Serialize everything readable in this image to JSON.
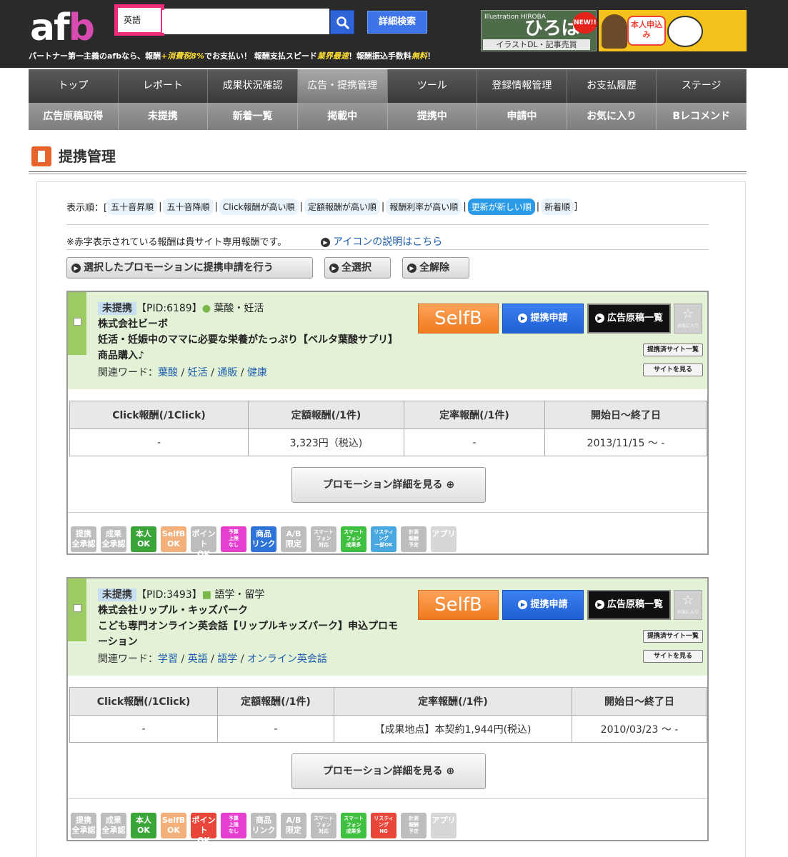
{
  "header": {
    "logo_a": "af",
    "logo_b": "b",
    "tagline_1": "パートナー第一主義のafbなら、報酬",
    "tagline_tax": "+消費税8%",
    "tagline_2": "でお支払い！ 報酬支払スピード",
    "tagline_fast": "業界最速",
    "tagline_3": "！報酬振込手数料",
    "tagline_free": "無料",
    "tagline_4": "！",
    "search_keyword": "英語",
    "search_placeholder": "",
    "advanced_search": "詳細検索",
    "banner1_small": "Illustration HIROBA",
    "banner1_title": "ひろば",
    "banner1_sub": "イラストDL・記事売買",
    "banner1_new": "NEW!!",
    "banner2_text": "本人申込み"
  },
  "nav1": [
    "トップ",
    "レポート",
    "成果状況確認",
    "広告・提携管理",
    "ツール",
    "登録情報管理",
    "お支払履歴",
    "ステージ"
  ],
  "nav1_active": 3,
  "nav2": [
    "広告原稿取得",
    "未提携",
    "新着一覧",
    "掲載中",
    "提携中",
    "申請中",
    "お気に入り",
    "Bレコメンド"
  ],
  "page_title": "提携管理",
  "sort": {
    "label": "表示順：[",
    "close": "]",
    "options": [
      "五十音昇順",
      "五十音降順",
      "Click報酬が高い順",
      "定額報酬が高い順",
      "報酬利率が高い順",
      "更新が新しい順",
      "新着順"
    ],
    "selected": 5
  },
  "note": "※赤字表示されている報酬は貴サイト専用報酬です。",
  "icon_help_link": "アイコンの説明はこちら",
  "actions": {
    "apply_selected": "選択したプロモーションに提携申請を行う",
    "select_all": "全選択",
    "clear_all": "全解除"
  },
  "promotions": [
    {
      "status": "未提携",
      "pid": "【PID:6189】",
      "category": "葉酸・妊活",
      "company": "株式会社ビーボ",
      "description": "妊活・妊娠中のママに必要な栄養がたっぷり【ベルタ葉酸サプリ】商品購入♪",
      "keywords_label": "関連ワード：",
      "keywords": [
        "葉酸",
        "妊活",
        "通販",
        "健康"
      ],
      "selfb": "SelfB",
      "apply": "提携申請",
      "ad_list": "広告原稿一覧",
      "fav": "☆",
      "fav_sub": "お気に入り",
      "affiliated_sites": "提携済サイト一覧",
      "view_site": "サイトを見る",
      "headers": [
        "Click報酬(/1Click)",
        "定額報酬(/1件)",
        "定率報酬(/1件)",
        "開始日〜終了日"
      ],
      "values": [
        "-",
        "3,323円（税込)",
        "-",
        "2013/11/15 〜 -"
      ],
      "detail": "プロモーション詳細を見る",
      "icons": [
        {
          "t": "提携\n全承認",
          "c": "#bdbdbd"
        },
        {
          "t": "成果\n全承認",
          "c": "#bdbdbd"
        },
        {
          "t": "本人\nOK",
          "c": "#3aa63a"
        },
        {
          "t": "SelfB\nOK",
          "c": "#f3b07a"
        },
        {
          "t": "ポイント\nOK",
          "c": "#bdbdbd"
        },
        {
          "t": "予算\n上限\nなし",
          "c": "#e63fd0"
        },
        {
          "t": "商品\nリンク",
          "c": "#2e74d8"
        },
        {
          "t": "A/B\n限定",
          "c": "#bdbdbd"
        },
        {
          "t": "スマート\nフォン\n対応",
          "c": "#bdbdbd"
        },
        {
          "t": "スマート\nフォン\n成果多",
          "c": "#40c040"
        },
        {
          "t": "リスティ\nング\n一部OK",
          "c": "#4aa8e0"
        },
        {
          "t": "計測\n報酬\n予定",
          "c": "#bdbdbd"
        },
        {
          "t": "アプリ",
          "c": "#d6d6d6"
        }
      ]
    },
    {
      "status": "未提携",
      "pid": "【PID:3493】",
      "category": "語学・留学",
      "company": "株式会社リップル・キッズパーク",
      "description": "こども専門オンライン英会話【リップルキッズパーク】申込プロモーション",
      "keywords_label": "関連ワード：",
      "keywords": [
        "学習",
        "英語",
        "語学",
        "オンライン英会話"
      ],
      "selfb": "SelfB",
      "apply": "提携申請",
      "ad_list": "広告原稿一覧",
      "fav": "☆",
      "fav_sub": "お気に入り",
      "affiliated_sites": "提携済サイト一覧",
      "view_site": "サイトを見る",
      "headers": [
        "Click報酬(/1Click)",
        "定額報酬(/1件)",
        "定率報酬(/1件)",
        "開始日〜終了日"
      ],
      "values": [
        "-",
        "-",
        "【成果地点】本契約1,944円(税込)",
        "2010/03/23 〜 -"
      ],
      "detail": "プロモーション詳細を見る",
      "icons": [
        {
          "t": "提携\n全承認",
          "c": "#bdbdbd"
        },
        {
          "t": "成果\n全承認",
          "c": "#bdbdbd"
        },
        {
          "t": "本人\nOK",
          "c": "#3aa63a"
        },
        {
          "t": "SelfB\nOK",
          "c": "#f3b07a"
        },
        {
          "t": "ポイント\nOK",
          "c": "#e8463a"
        },
        {
          "t": "予算\n上限\nなし",
          "c": "#e63fd0"
        },
        {
          "t": "商品\nリンク",
          "c": "#bdbdbd"
        },
        {
          "t": "A/B\n限定",
          "c": "#bdbdbd"
        },
        {
          "t": "スマート\nフォン\n対応",
          "c": "#bdbdbd"
        },
        {
          "t": "スマート\nフォン\n成果多",
          "c": "#40c040"
        },
        {
          "t": "リスティ\nング\nNG",
          "c": "#e8463a"
        },
        {
          "t": "計測\n報酬\n予定",
          "c": "#bdbdbd"
        },
        {
          "t": "アプリ",
          "c": "#d6d6d6"
        }
      ]
    }
  ]
}
